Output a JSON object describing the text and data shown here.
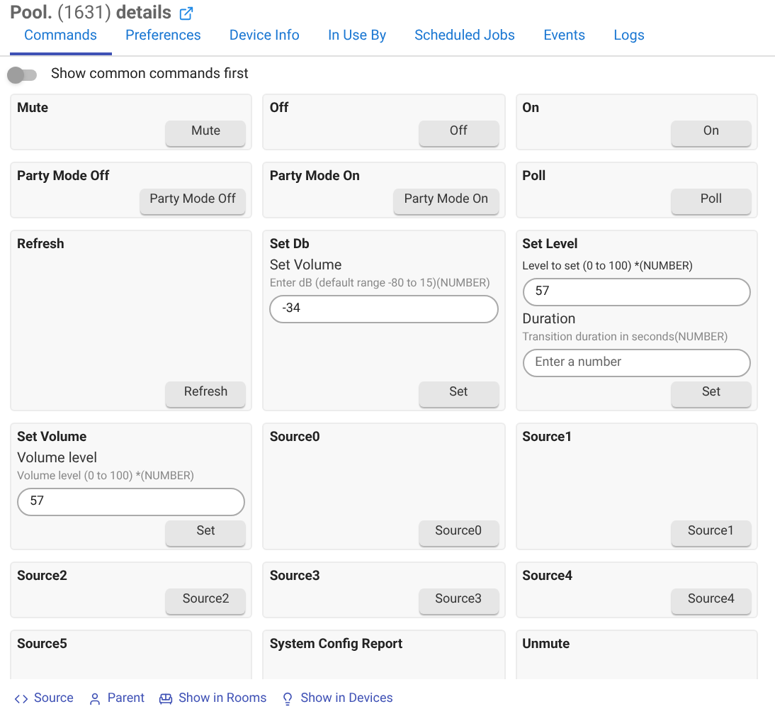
{
  "header": {
    "title": "**Pool.** (1631) **details**"
  },
  "tabs": [
    {
      "label": "Commands",
      "selected": true
    },
    {
      "label": "Preferences",
      "selected": false
    },
    {
      "label": "Device Info",
      "selected": false
    },
    {
      "label": "In Use By",
      "selected": false
    },
    {
      "label": "Scheduled Jobs",
      "selected": false
    },
    {
      "label": "Events",
      "selected": false
    },
    {
      "label": "Logs",
      "selected": false
    }
  ],
  "toggle": {
    "label": "Show common commands first",
    "on": false
  },
  "commands": [
    {
      "title": "Mute",
      "button": "Mute"
    },
    {
      "title": "Off",
      "button": "Off"
    },
    {
      "title": "On",
      "button": "On"
    },
    {
      "title": "Party Mode Off",
      "button": "Party Mode Off"
    },
    {
      "title": "Party Mode On",
      "button": "Party Mode On"
    },
    {
      "title": "Poll",
      "button": "Poll"
    },
    {
      "title": "Refresh",
      "button": "Refresh"
    },
    {
      "title": "Set Db",
      "button": "Set",
      "fields": [
        {
          "label": "Set Volume",
          "hint": "Enter dB (default range -80 to 15)(NUMBER)",
          "value": "-34"
        }
      ]
    },
    {
      "title": "Set Level",
      "button": "Set",
      "fields": [
        {
          "hint": "Level to set (0 to 100) *(NUMBER)",
          "value": "57"
        },
        {
          "label": "Duration",
          "hint": "Transition duration in seconds(NUMBER)",
          "placeholder": "Enter a number"
        }
      ]
    },
    {
      "title": "Set Volume",
      "button": "Set",
      "fields": [
        {
          "label": "Volume level",
          "hint": "Volume level (0 to 100) *(NUMBER)",
          "value": "57"
        }
      ]
    },
    {
      "title": "Source0",
      "button": "Source0"
    },
    {
      "title": "Source1",
      "button": "Source1"
    },
    {
      "title": "Source2",
      "button": "Source2"
    },
    {
      "title": "Source3",
      "button": "Source3"
    },
    {
      "title": "Source4",
      "button": "Source4"
    },
    {
      "title": "Source5"
    },
    {
      "title": "System Config Report"
    },
    {
      "title": "Unmute"
    }
  ],
  "footer_links": [
    {
      "kind": "code",
      "label": "Source"
    },
    {
      "kind": "person",
      "label": "Parent"
    },
    {
      "kind": "sofa",
      "label": "Show in Rooms"
    },
    {
      "kind": "bulb",
      "label": "Show in Devices"
    }
  ]
}
